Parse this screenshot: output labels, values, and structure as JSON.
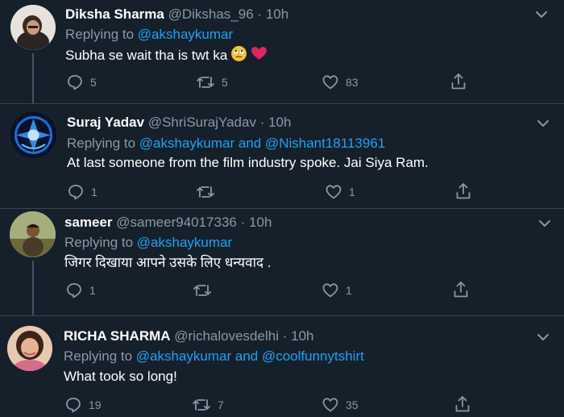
{
  "tweets": [
    {
      "name": "Diksha Sharma",
      "handle": "@Dikshas_96",
      "time": "10h",
      "replying_prefix": "Replying to",
      "mentions": "@akshaykumar",
      "text": "Subha se wait tha is twt ka",
      "emoji_icons": [
        "rolling-eyes-emoji",
        "red-heart-emoji"
      ],
      "replies": "5",
      "retweets": "5",
      "likes": "83"
    },
    {
      "name": "Suraj Yadav",
      "handle": "@ShriSurajYadav",
      "time": "10h",
      "replying_prefix": "Replying to",
      "mentions": "@akshaykumar and @Nishant18113961",
      "text": "At last someone from the film industry spoke. Jai Siya Ram.",
      "replies": "1",
      "retweets": "",
      "likes": "1"
    },
    {
      "name": "sameer",
      "handle": "@sameer94017336",
      "time": "10h",
      "replying_prefix": "Replying to",
      "mentions": "@akshaykumar",
      "text": "जिगर दिखाया आपने उसके लिए धन्यवाद .",
      "replies": "1",
      "retweets": "",
      "likes": "1"
    },
    {
      "name": "RICHA SHARMA",
      "handle": "@richalovesdelhi",
      "time": "10h",
      "replying_prefix": "Replying to",
      "mentions": "@akshaykumar and @coolfunnytshirt",
      "text": "What took so long!",
      "replies": "19",
      "retweets": "7",
      "likes": "35"
    }
  ],
  "separator": "·",
  "colors": {
    "background": "#15202b",
    "divider": "#38444d",
    "secondary_text": "#8899a6",
    "link": "#1da1f2"
  },
  "icons": [
    "reply-icon",
    "retweet-icon",
    "like-icon",
    "share-icon",
    "chevron-down-icon"
  ]
}
